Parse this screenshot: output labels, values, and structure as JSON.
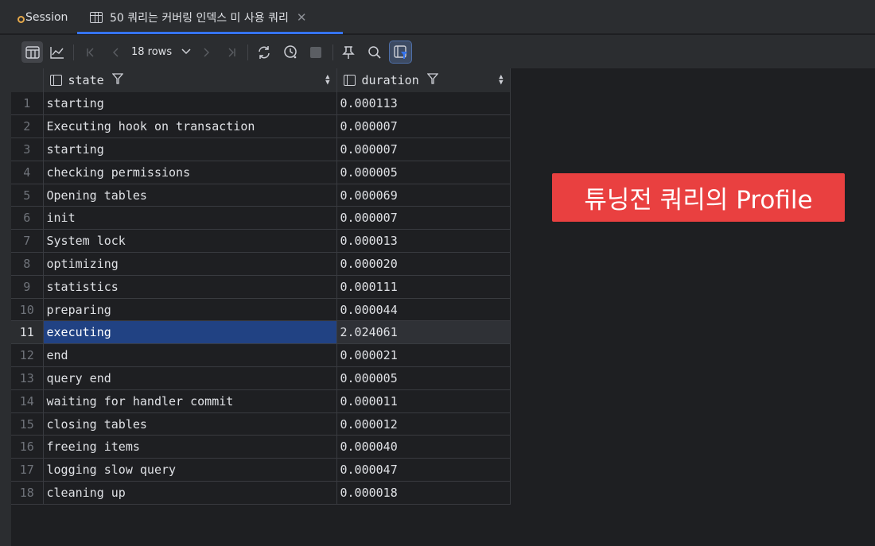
{
  "tabs": {
    "session_label": "Session",
    "active_label": "50 쿼리는 커버링 인덱스 미 사용 쿼리",
    "close_glyph": "✕"
  },
  "toolbar": {
    "rows_label": "18 rows"
  },
  "columns": [
    {
      "name": "state"
    },
    {
      "name": "duration"
    }
  ],
  "rows": [
    {
      "n": "1",
      "state": "starting",
      "duration": "0.000113"
    },
    {
      "n": "2",
      "state": "Executing hook on transaction",
      "duration": "0.000007"
    },
    {
      "n": "3",
      "state": "starting",
      "duration": "0.000007"
    },
    {
      "n": "4",
      "state": "checking permissions",
      "duration": "0.000005"
    },
    {
      "n": "5",
      "state": "Opening tables",
      "duration": "0.000069"
    },
    {
      "n": "6",
      "state": "init",
      "duration": "0.000007"
    },
    {
      "n": "7",
      "state": "System lock",
      "duration": "0.000013"
    },
    {
      "n": "8",
      "state": "optimizing",
      "duration": "0.000020"
    },
    {
      "n": "9",
      "state": "statistics",
      "duration": "0.000111"
    },
    {
      "n": "10",
      "state": "preparing",
      "duration": "0.000044"
    },
    {
      "n": "11",
      "state": "executing",
      "duration": "2.024061"
    },
    {
      "n": "12",
      "state": "end",
      "duration": "0.000021"
    },
    {
      "n": "13",
      "state": "query end",
      "duration": "0.000005"
    },
    {
      "n": "14",
      "state": "waiting for handler commit",
      "duration": "0.000011"
    },
    {
      "n": "15",
      "state": "closing tables",
      "duration": "0.000012"
    },
    {
      "n": "16",
      "state": "freeing items",
      "duration": "0.000040"
    },
    {
      "n": "17",
      "state": "logging slow query",
      "duration": "0.000047"
    },
    {
      "n": "18",
      "state": "cleaning up",
      "duration": "0.000018"
    }
  ],
  "selected_row": "11",
  "annotation": "튜닝전 쿼리의 Profile",
  "colors": {
    "background": "#1e1f22",
    "panel": "#2b2d30",
    "selection": "#214283",
    "accent": "#3574f0",
    "annotation": "#e94040"
  }
}
